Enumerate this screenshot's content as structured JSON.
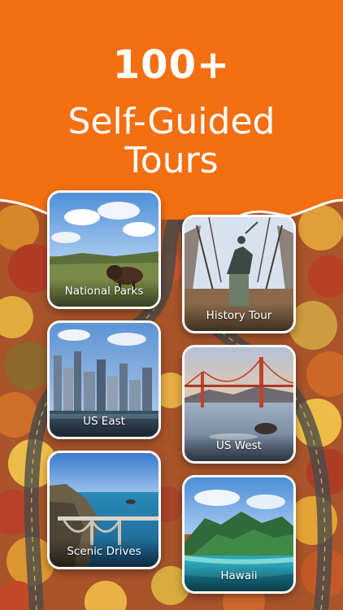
{
  "header": {
    "count": "100+",
    "title_line1": "Self-Guided",
    "title_line2": "Tours",
    "background_color": "#f36f12"
  },
  "tours": [
    {
      "label": "National Parks",
      "image_icon": "bison-prairie-photo"
    },
    {
      "label": "History Tour",
      "image_icon": "equestrian-statue-photo"
    },
    {
      "label": "US East",
      "image_icon": "city-skyline-photo"
    },
    {
      "label": "US West",
      "image_icon": "golden-gate-bridge-photo"
    },
    {
      "label": "Scenic Drives",
      "image_icon": "coastal-bridge-photo"
    },
    {
      "label": "Hawaii",
      "image_icon": "tropical-coast-photo"
    }
  ]
}
